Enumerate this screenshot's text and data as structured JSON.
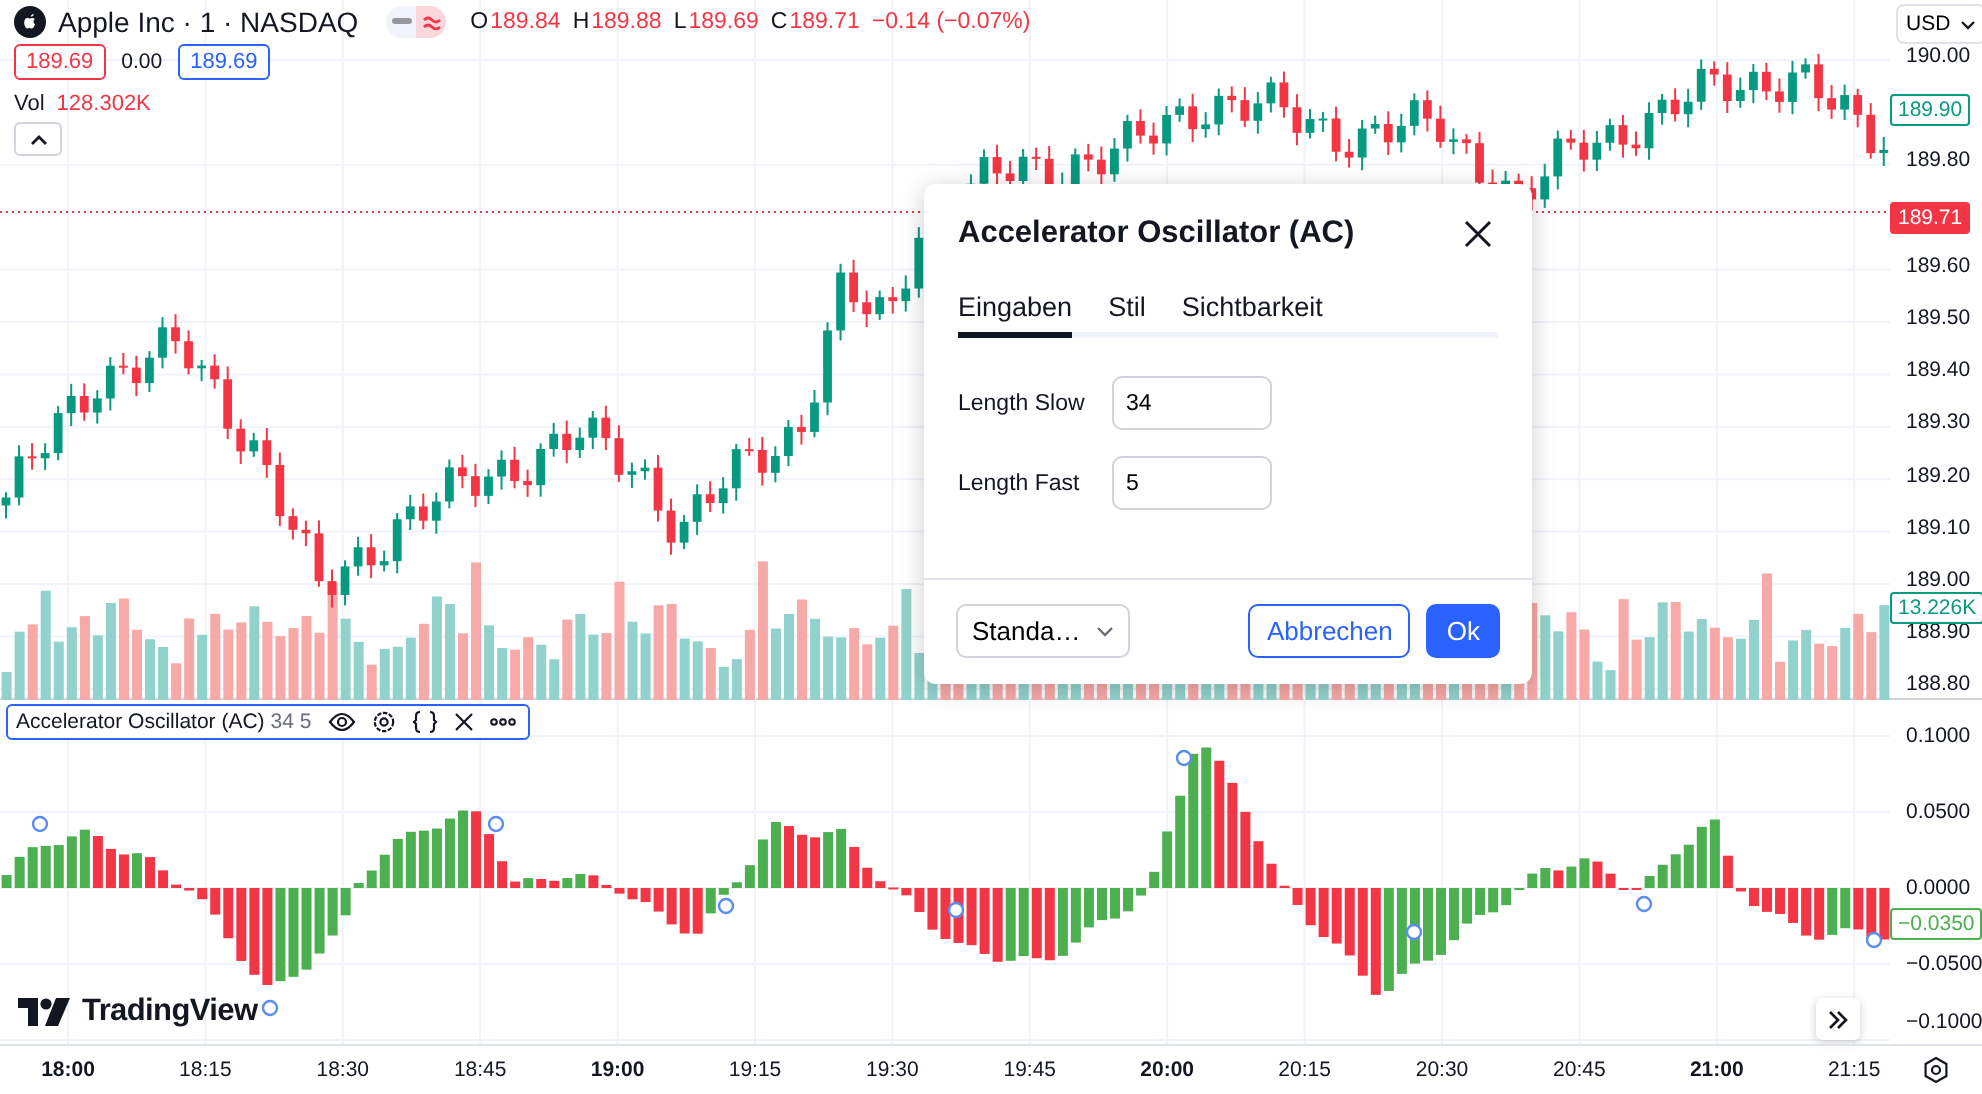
{
  "legend": {
    "symbol": "Apple Inc · 1 · NASDAQ",
    "ohlc": [
      {
        "key": "O",
        "value": "189.84"
      },
      {
        "key": "H",
        "value": "189.88"
      },
      {
        "key": "L",
        "value": "189.69"
      },
      {
        "key": "C",
        "value": "189.71"
      }
    ],
    "change": "−0.14 (−0.07%)",
    "bid": "189.69",
    "spread": "0.00",
    "ask": "189.69",
    "volume_label": "Vol",
    "volume_value": "128.302K"
  },
  "currency": "USD",
  "price_scale": [
    "190.00",
    "189.80",
    "189.60",
    "189.50",
    "189.40",
    "189.30",
    "189.20",
    "189.10",
    "189.00",
    "188.90",
    "188.80"
  ],
  "price_tags": [
    {
      "kind": "outline",
      "text": "189.90",
      "color": "#089981"
    },
    {
      "kind": "filled",
      "text": "189.71",
      "color": "#f23645"
    },
    {
      "kind": "outline",
      "text": "13.226K",
      "color": "#089981"
    }
  ],
  "indicator": {
    "name": "Accelerator Oscillator (AC)",
    "params": "34 5"
  },
  "oscillator_scale": [
    "0.1000",
    "0.0500",
    "0.0000",
    "−0.0500",
    "−0.1000"
  ],
  "oscillator_tag": {
    "text": "−0.0350",
    "color": "#4caf50"
  },
  "time_axis": [
    {
      "label": "18:00",
      "major": true
    },
    {
      "label": "18:15",
      "major": false
    },
    {
      "label": "18:30",
      "major": false
    },
    {
      "label": "18:45",
      "major": false
    },
    {
      "label": "19:00",
      "major": true
    },
    {
      "label": "19:15",
      "major": false
    },
    {
      "label": "19:30",
      "major": false
    },
    {
      "label": "19:45",
      "major": false
    },
    {
      "label": "20:00",
      "major": true
    },
    {
      "label": "20:15",
      "major": false
    },
    {
      "label": "20:30",
      "major": false
    },
    {
      "label": "20:45",
      "major": false
    },
    {
      "label": "21:00",
      "major": true
    },
    {
      "label": "21:15",
      "major": false
    }
  ],
  "logo": "TradingView",
  "dialog": {
    "title": "Accelerator Oscillator (AC)",
    "tabs": [
      {
        "label": "Eingaben",
        "selected": true
      },
      {
        "label": "Stil",
        "selected": false
      },
      {
        "label": "Sichtbarkeit",
        "selected": false
      }
    ],
    "fields": [
      {
        "label": "Length Slow",
        "value": "34"
      },
      {
        "label": "Length Fast",
        "value": "5"
      }
    ],
    "preset": "Standa…",
    "cancel": "Abbrechen",
    "ok": "Ok"
  }
}
